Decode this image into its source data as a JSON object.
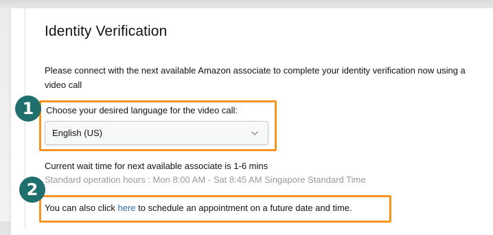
{
  "page": {
    "title": "Identity Verification",
    "intro": "Please connect with the next available Amazon associate to complete your identity verification now using a video call"
  },
  "language": {
    "label": "Choose your desired language for the video call:",
    "selected": "English (US)"
  },
  "wait": {
    "text": "Current wait time for next available associate is 1-6 mins",
    "hours": "Standard operation hours : Mon 8:00 AM - Sat 8:45 AM Singapore Standard Time"
  },
  "schedule": {
    "before": "You can also click ",
    "link": "here",
    "after": " to schedule an appointment on a future date and time."
  },
  "callouts": {
    "badge_1": "1",
    "badge_2": "2"
  },
  "colors": {
    "highlight": "#f7941d",
    "badge": "#1f6f6d",
    "link": "#2a6bb6"
  }
}
